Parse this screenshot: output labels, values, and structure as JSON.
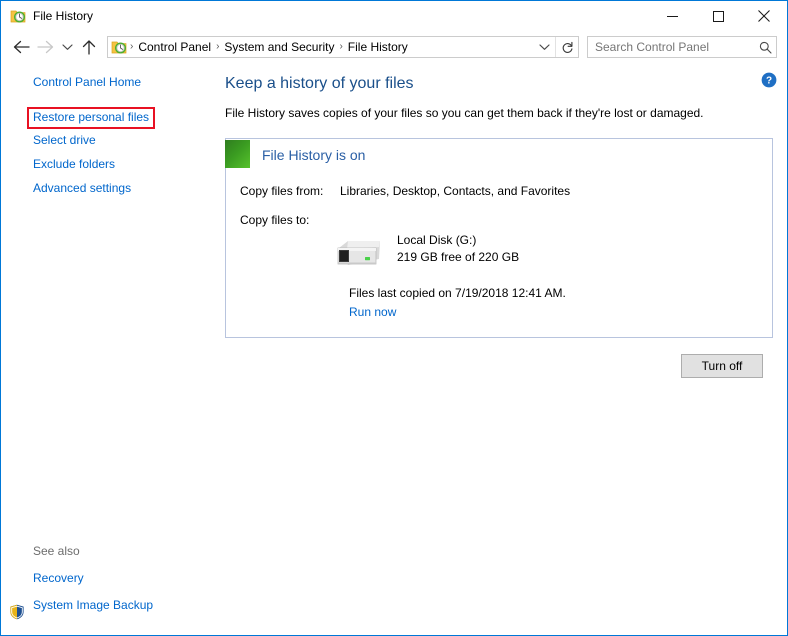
{
  "window": {
    "title": "File History",
    "title_icon": "file-history-icon",
    "minimize_label": "Minimize",
    "maximize_label": "Maximize",
    "close_label": "Close"
  },
  "navbar": {
    "back_label": "Back",
    "forward_label": "Forward",
    "recent_label": "Recent locations",
    "up_label": "Up",
    "breadcrumbs": [
      {
        "label": "Control Panel"
      },
      {
        "label": "System and Security"
      },
      {
        "label": "File History"
      }
    ],
    "separator": "›",
    "dropdown_label": "Previous locations",
    "refresh_label": "Refresh",
    "search": {
      "placeholder": "Search Control Panel",
      "value": ""
    }
  },
  "help": {
    "label": "Help",
    "glyph": "?"
  },
  "sidebar": {
    "home_label": "Control Panel Home",
    "items": [
      {
        "label": "Restore personal files",
        "highlighted": true
      },
      {
        "label": "Select drive",
        "highlighted": false
      },
      {
        "label": "Exclude folders",
        "highlighted": false
      },
      {
        "label": "Advanced settings",
        "highlighted": false
      }
    ],
    "see_also": {
      "title": "See also",
      "items": [
        {
          "label": "Recovery",
          "icon": ""
        },
        {
          "label": "System Image Backup",
          "icon": "uac-shield-icon"
        }
      ]
    }
  },
  "main": {
    "heading": "Keep a history of your files",
    "description": "File History saves copies of your files so you can get them back if they're lost or damaged.",
    "status": {
      "label": "File History is on",
      "swatch_color": "#3a9b21"
    },
    "copy_from_label": "Copy files from:",
    "copy_from_value": "Libraries, Desktop, Contacts, and Favorites",
    "copy_to_label": "Copy files to:",
    "drive": {
      "name": "Local Disk (G:)",
      "capacity": "219 GB free of 220 GB"
    },
    "last_copied": "Files last copied on 7/19/2018 12:41 AM.",
    "run_now_label": "Run now",
    "turn_off_label": "Turn off"
  },
  "colors": {
    "link": "#0066cc",
    "heading": "#1a4f8a",
    "status_text": "#2a5fa5",
    "highlight_border": "#e81123",
    "window_border": "#0078d7",
    "panel_border": "#b8c4de"
  }
}
